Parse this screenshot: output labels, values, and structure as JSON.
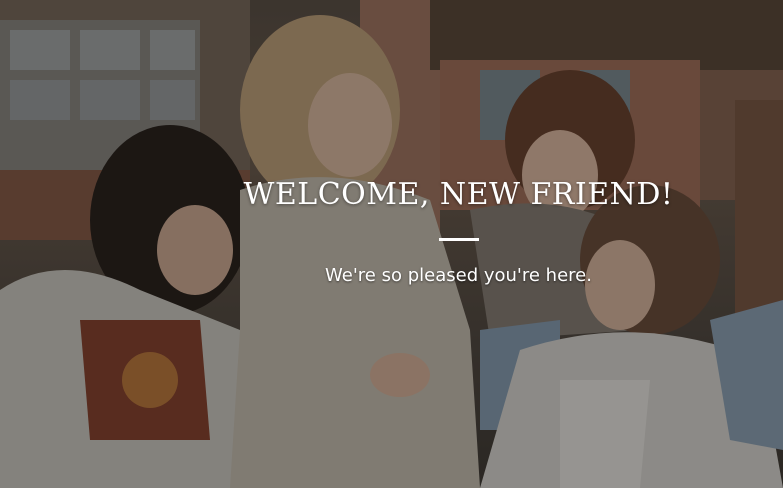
{
  "hero": {
    "title": "WELCOME, NEW FRIEND!",
    "subtitle": "We're so pleased you're here.",
    "overlay_color": "#141210",
    "text_color": "#ffffff",
    "background_image": "photo of four smiling women laughing together outdoors"
  }
}
